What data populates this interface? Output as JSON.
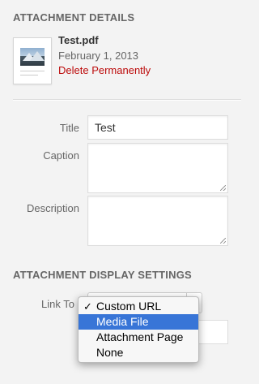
{
  "details": {
    "title": "ATTACHMENT DETAILS",
    "file_name": "Test.pdf",
    "file_date": "February 1, 2013",
    "delete_label": "Delete Permanently"
  },
  "fields": {
    "title_label": "Title",
    "title_value": "Test",
    "caption_label": "Caption",
    "caption_value": "",
    "description_label": "Description",
    "description_value": ""
  },
  "display_settings": {
    "title": "ATTACHMENT DISPLAY SETTINGS",
    "link_to_label": "Link To",
    "options": [
      "Custom URL",
      "Media File",
      "Attachment Page",
      "None"
    ],
    "checked_index": 0,
    "highlighted_index": 1
  },
  "colors": {
    "delete": "#bc0b0b",
    "highlight": "#3875d7"
  },
  "icons": {
    "file_thumbnail": "document-thumbnail-icon",
    "check": "checkmark-icon",
    "resize": "resize-grip-icon"
  }
}
